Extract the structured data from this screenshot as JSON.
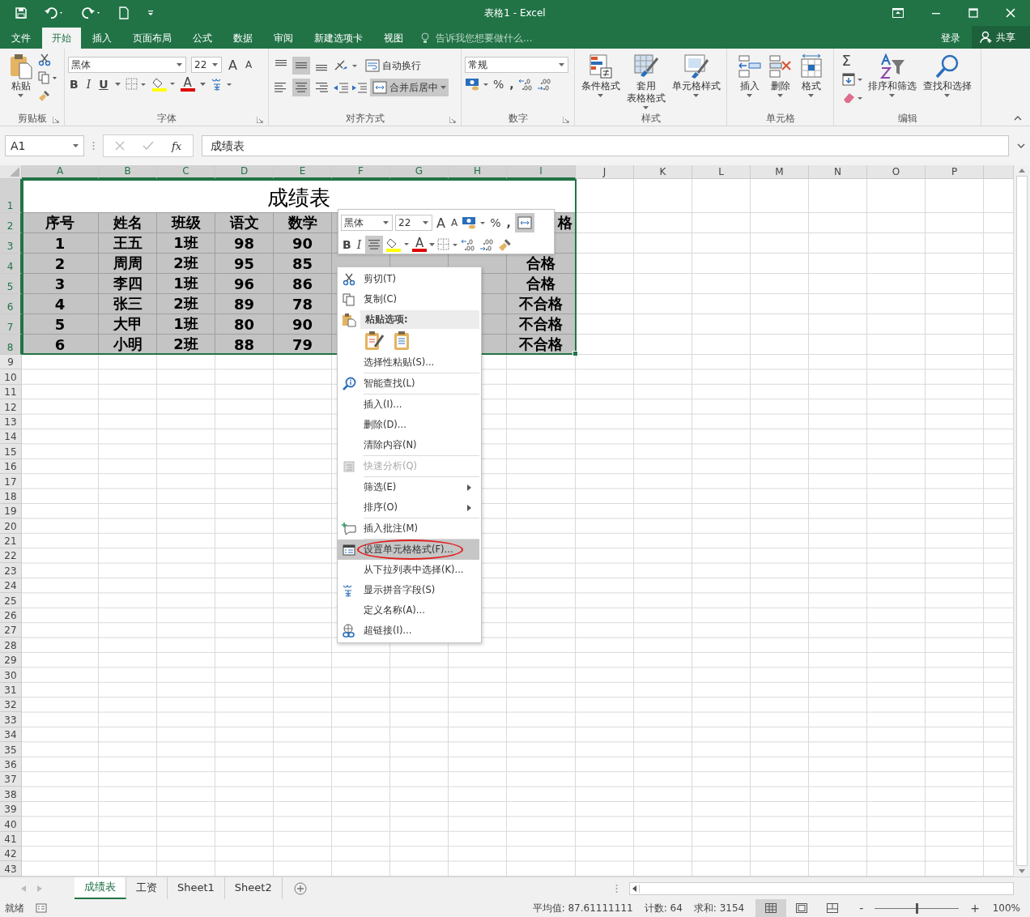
{
  "title_bar": {
    "title": "表格1 - Excel"
  },
  "ribbon_tabs": [
    {
      "label": "文件",
      "selected": false
    },
    {
      "label": "开始",
      "selected": true
    },
    {
      "label": "插入",
      "selected": false
    },
    {
      "label": "页面布局",
      "selected": false
    },
    {
      "label": "公式",
      "selected": false
    },
    {
      "label": "数据",
      "selected": false
    },
    {
      "label": "审阅",
      "selected": false
    },
    {
      "label": "新建选项卡",
      "selected": false
    },
    {
      "label": "视图",
      "selected": false
    }
  ],
  "tell_me": {
    "placeholder": "告诉我您想要做什么..."
  },
  "sign_in": "登录",
  "share": "共享",
  "clipboard": {
    "paste": "粘贴",
    "label": "剪贴板"
  },
  "font": {
    "name": "黑体",
    "size": "22",
    "grow": "A",
    "shrink": "A",
    "bold": "B",
    "italic": "I",
    "underline": "U",
    "font_color": "A",
    "label": "字体"
  },
  "alignment": {
    "vertical_buttons": [
      {
        "selected": false
      },
      {
        "selected": true
      },
      {
        "selected": false
      }
    ],
    "horizontal_buttons": [
      {
        "selected": false
      },
      {
        "selected": true
      },
      {
        "selected": false
      }
    ],
    "wrap": "自动换行",
    "merge": {
      "label": "合并后居中",
      "selected": true
    },
    "label": "对齐方式"
  },
  "number": {
    "format": "常规",
    "percent": "%",
    "comma": ",",
    "label": "数字"
  },
  "styles": {
    "buttons": [
      [
        "条件格式"
      ],
      [
        "套用",
        "表格格式"
      ],
      [
        "单元格样式"
      ]
    ],
    "label": "样式"
  },
  "cells": {
    "buttons": [
      "插入",
      "删除",
      "格式"
    ],
    "label": "单元格"
  },
  "editing": {
    "autosum": "Σ",
    "buttons": [
      "排序和筛选",
      "查找和选择"
    ],
    "label": "编辑"
  },
  "formula_bar": {
    "name_box": "A1",
    "function_button": "fx",
    "formula": "成绩表"
  },
  "columns": [
    {
      "label": "A",
      "selected": true
    },
    {
      "label": "B",
      "selected": true
    },
    {
      "label": "C",
      "selected": true
    },
    {
      "label": "D",
      "selected": true
    },
    {
      "label": "E",
      "selected": true
    },
    {
      "label": "F",
      "selected": true
    },
    {
      "label": "G",
      "selected": true
    },
    {
      "label": "H",
      "selected": true
    },
    {
      "label": "I",
      "selected": true
    },
    {
      "label": "J",
      "selected": false
    },
    {
      "label": "K",
      "selected": false
    },
    {
      "label": "L",
      "selected": false
    },
    {
      "label": "M",
      "selected": false
    },
    {
      "label": "N",
      "selected": false
    },
    {
      "label": "O",
      "selected": false
    },
    {
      "label": "P",
      "selected": false
    }
  ],
  "rows": [
    {
      "label": "1",
      "selected": true
    },
    {
      "label": "2",
      "selected": true
    },
    {
      "label": "3",
      "selected": true
    },
    {
      "label": "4",
      "selected": true
    },
    {
      "label": "5",
      "selected": true
    },
    {
      "label": "6",
      "selected": true
    },
    {
      "label": "7",
      "selected": true
    },
    {
      "label": "8",
      "selected": true
    },
    {
      "label": "9",
      "selected": false
    },
    {
      "label": "10",
      "selected": false
    },
    {
      "label": "11",
      "selected": false
    },
    {
      "label": "12",
      "selected": false
    },
    {
      "label": "13",
      "selected": false
    },
    {
      "label": "14",
      "selected": false
    },
    {
      "label": "15",
      "selected": false
    },
    {
      "label": "16",
      "selected": false
    },
    {
      "label": "17",
      "selected": false
    },
    {
      "label": "18",
      "selected": false
    },
    {
      "label": "19",
      "selected": false
    },
    {
      "label": "20",
      "selected": false
    },
    {
      "label": "21",
      "selected": false
    },
    {
      "label": "22",
      "selected": false
    },
    {
      "label": "23",
      "selected": false
    },
    {
      "label": "24",
      "selected": false
    },
    {
      "label": "25",
      "selected": false
    },
    {
      "label": "26",
      "selected": false
    },
    {
      "label": "27",
      "selected": false
    },
    {
      "label": "28",
      "selected": false
    },
    {
      "label": "29",
      "selected": false
    },
    {
      "label": "30",
      "selected": false
    },
    {
      "label": "31",
      "selected": false
    },
    {
      "label": "32",
      "selected": false
    },
    {
      "label": "33",
      "selected": false
    },
    {
      "label": "34",
      "selected": false
    },
    {
      "label": "35",
      "selected": false
    },
    {
      "label": "36",
      "selected": false
    },
    {
      "label": "37",
      "selected": false
    },
    {
      "label": "38",
      "selected": false
    },
    {
      "label": "39",
      "selected": false
    },
    {
      "label": "40",
      "selected": false
    },
    {
      "label": "41",
      "selected": false
    },
    {
      "label": "42",
      "selected": false
    },
    {
      "label": "43",
      "selected": false
    }
  ],
  "sheet_title": "成绩表",
  "table_rows": [
    [
      "序号",
      "姓名",
      "班级",
      "语文",
      "数学",
      null,
      null,
      null,
      "格"
    ],
    [
      "1",
      "王五",
      "1班",
      "98",
      "90",
      null,
      null,
      null,
      null
    ],
    [
      "2",
      "周周",
      "2班",
      "95",
      "85",
      null,
      null,
      null,
      "合格"
    ],
    [
      "3",
      "李四",
      "1班",
      "96",
      "86",
      null,
      null,
      null,
      "合格"
    ],
    [
      "4",
      "张三",
      "2班",
      "89",
      "78",
      null,
      null,
      null,
      "不合格"
    ],
    [
      "5",
      "大甲",
      "1班",
      "80",
      "90",
      null,
      null,
      null,
      "不合格"
    ],
    [
      "6",
      "小明",
      "2班",
      "88",
      "79",
      null,
      null,
      null,
      "不合格"
    ]
  ],
  "mini_toolbar": {
    "font": "黑体",
    "size": "22",
    "grow": "A",
    "shrink": "A",
    "percent": "%",
    "comma": ",",
    "merge_selected": true,
    "bold": "B",
    "italic": "I",
    "center_selected": true,
    "font_color": "A"
  },
  "context_menu": [
    {
      "kind": "item",
      "label": "剪切(T)",
      "disabled": false,
      "submenu": false,
      "selected": false,
      "circled": false
    },
    {
      "kind": "item",
      "label": "复制(C)",
      "disabled": false,
      "submenu": false,
      "selected": false,
      "circled": false
    },
    {
      "kind": "header",
      "label": "粘贴选项:"
    },
    {
      "kind": "paste_options"
    },
    {
      "kind": "item",
      "label": "选择性粘贴(S)...",
      "disabled": false,
      "submenu": false,
      "selected": false,
      "circled": false
    },
    {
      "kind": "separator"
    },
    {
      "kind": "item",
      "label": "智能查找(L)",
      "disabled": false,
      "submenu": false,
      "selected": false,
      "circled": false
    },
    {
      "kind": "separator"
    },
    {
      "kind": "item",
      "label": "插入(I)...",
      "disabled": false,
      "submenu": false,
      "selected": false,
      "circled": false
    },
    {
      "kind": "item",
      "label": "删除(D)...",
      "disabled": false,
      "submenu": false,
      "selected": false,
      "circled": false
    },
    {
      "kind": "item",
      "label": "清除内容(N)",
      "disabled": false,
      "submenu": false,
      "selected": false,
      "circled": false
    },
    {
      "kind": "separator"
    },
    {
      "kind": "item",
      "label": "快速分析(Q)",
      "disabled": true,
      "submenu": false,
      "selected": false,
      "circled": false
    },
    {
      "kind": "separator"
    },
    {
      "kind": "item",
      "label": "筛选(E)",
      "disabled": false,
      "submenu": true,
      "selected": false,
      "circled": false
    },
    {
      "kind": "item",
      "label": "排序(O)",
      "disabled": false,
      "submenu": true,
      "selected": false,
      "circled": false
    },
    {
      "kind": "separator"
    },
    {
      "kind": "item",
      "label": "插入批注(M)",
      "disabled": false,
      "submenu": false,
      "selected": false,
      "circled": false
    },
    {
      "kind": "separator"
    },
    {
      "kind": "item",
      "label": "设置单元格格式(F)...",
      "disabled": false,
      "submenu": false,
      "selected": true,
      "circled": true
    },
    {
      "kind": "item",
      "label": "从下拉列表中选择(K)...",
      "disabled": false,
      "submenu": false,
      "selected": false,
      "circled": false
    },
    {
      "kind": "item",
      "label": "显示拼音字段(S)",
      "disabled": false,
      "submenu": false,
      "selected": false,
      "circled": false
    },
    {
      "kind": "item",
      "label": "定义名称(A)...",
      "disabled": false,
      "submenu": false,
      "selected": false,
      "circled": false
    },
    {
      "kind": "item",
      "label": "超链接(I)...",
      "disabled": false,
      "submenu": false,
      "selected": false,
      "circled": false
    }
  ],
  "sheet_tabs": [
    {
      "label": "成绩表",
      "selected": true
    },
    {
      "label": "工资",
      "selected": false
    },
    {
      "label": "Sheet1",
      "selected": false
    },
    {
      "label": "Sheet2",
      "selected": false
    }
  ],
  "status_bar": {
    "ready": "就绪",
    "average": "平均值: 87.61111111",
    "count": "计数: 64",
    "sum": "求和: 3154",
    "views": [
      {
        "selected": true
      },
      {
        "selected": false
      },
      {
        "selected": false
      }
    ],
    "zoom_out": "-",
    "zoom_in": "+",
    "zoom": {
      "level": 0.5
    },
    "zoom_label": "100%"
  }
}
